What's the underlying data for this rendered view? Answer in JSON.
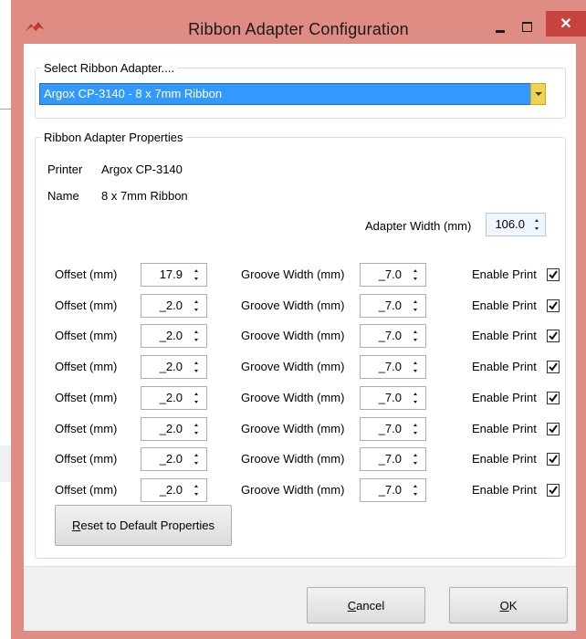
{
  "window": {
    "title": "Ribbon Adapter Configuration",
    "close_glyph": "✕"
  },
  "select_group": {
    "legend": "Select Ribbon Adapter....",
    "selected": "Argox CP-3140 - 8 x 7mm Ribbon"
  },
  "props_group": {
    "legend": "Ribbon Adapter Properties",
    "printer_label": "Printer",
    "printer_value": "Argox CP-3140",
    "name_label": "Name",
    "name_value": "8 x 7mm Ribbon",
    "adapter_width_label": "Adapter Width (mm)",
    "adapter_width_value": "106.0"
  },
  "rows": [
    {
      "offset_label": "Offset (mm)",
      "offset": "17.9",
      "groove_label": "Groove Width (mm)",
      "groove": "_7.0",
      "enable_label": "Enable Print",
      "enabled": true
    },
    {
      "offset_label": "Offset (mm)",
      "offset": "_2.0",
      "groove_label": "Groove Width (mm)",
      "groove": "_7.0",
      "enable_label": "Enable Print",
      "enabled": true
    },
    {
      "offset_label": "Offset (mm)",
      "offset": "_2.0",
      "groove_label": "Groove Width (mm)",
      "groove": "_7.0",
      "enable_label": "Enable Print",
      "enabled": true
    },
    {
      "offset_label": "Offset (mm)",
      "offset": "_2.0",
      "groove_label": "Groove Width (mm)",
      "groove": "_7.0",
      "enable_label": "Enable Print",
      "enabled": true
    },
    {
      "offset_label": "Offset (mm)",
      "offset": "_2.0",
      "groove_label": "Groove Width (mm)",
      "groove": "_7.0",
      "enable_label": "Enable Print",
      "enabled": true
    },
    {
      "offset_label": "Offset (mm)",
      "offset": "_2.0",
      "groove_label": "Groove Width (mm)",
      "groove": "_7.0",
      "enable_label": "Enable Print",
      "enabled": true
    },
    {
      "offset_label": "Offset (mm)",
      "offset": "_2.0",
      "groove_label": "Groove Width (mm)",
      "groove": "_7.0",
      "enable_label": "Enable Print",
      "enabled": true
    },
    {
      "offset_label": "Offset (mm)",
      "offset": "_2.0",
      "groove_label": "Groove Width (mm)",
      "groove": "_7.0",
      "enable_label": "Enable Print",
      "enabled": true
    }
  ],
  "reset_button": {
    "first": "R",
    "rest": "eset to Default Properties"
  },
  "cancel_button": {
    "first": "C",
    "rest": "ancel"
  },
  "ok_button": {
    "first": "O",
    "rest": "K"
  },
  "colors": {
    "frame": "#df8c84",
    "selection": "#3399ff",
    "close_button": "#c7433f",
    "combo_button": "#f2d24a"
  },
  "icons": [
    "app-icon",
    "minimize-icon",
    "maximize-icon",
    "close-icon",
    "dropdown-arrow-icon",
    "spin-arrows-icon",
    "checkmark-icon"
  ]
}
